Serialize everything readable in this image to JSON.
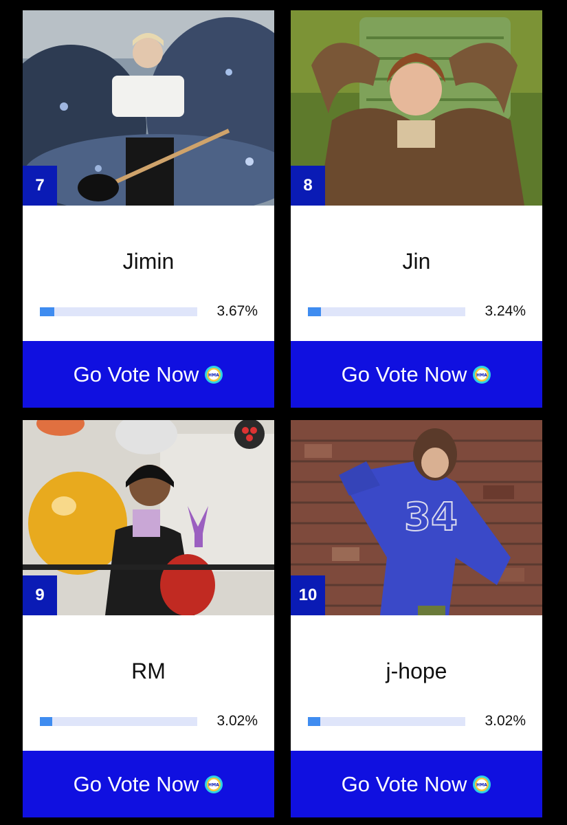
{
  "cards": [
    {
      "rank": "7",
      "name": "Jimin",
      "percent_label": "3.67%",
      "percent": 3.67,
      "bar_fill_fraction": 0.09,
      "button_label": "Go Vote Now",
      "logo_text": "HMA"
    },
    {
      "rank": "8",
      "name": "Jin",
      "percent_label": "3.24%",
      "percent": 3.24,
      "bar_fill_fraction": 0.085,
      "button_label": "Go Vote Now",
      "logo_text": "HMA"
    },
    {
      "rank": "9",
      "name": "RM",
      "percent_label": "3.02%",
      "percent": 3.02,
      "bar_fill_fraction": 0.08,
      "button_label": "Go Vote Now",
      "logo_text": "HMA"
    },
    {
      "rank": "10",
      "name": "j-hope",
      "percent_label": "3.02%",
      "percent": 3.02,
      "bar_fill_fraction": 0.08,
      "button_label": "Go Vote Now",
      "logo_text": "HMA"
    }
  ],
  "colors": {
    "background": "#000000",
    "rank_badge": "#0a1bb5",
    "button": "#1010e0",
    "bar_track": "#dfe5fa",
    "bar_fill": "#3f8cf0"
  }
}
